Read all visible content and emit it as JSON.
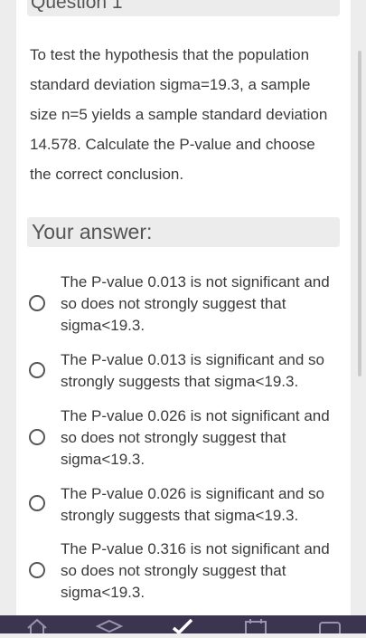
{
  "question": {
    "title": "Question 1",
    "text": "To test the hypothesis that the population standard deviation sigma=19.3, a sample size n=5 yields a sample standard deviation 14.578. Calculate the P-value and choose the correct conclusion."
  },
  "answer_header": "Your answer:",
  "options": [
    {
      "label": "The P-value 0.013 is not significant and so does not strongly suggest that sigma<19.3."
    },
    {
      "label": "The P-value 0.013 is significant and so strongly suggests that sigma<19.3."
    },
    {
      "label": "The P-value 0.026 is not significant and so does not strongly suggest that sigma<19.3."
    },
    {
      "label": "The P-value 0.026 is significant and so strongly suggests that sigma<19.3."
    },
    {
      "label": "The P-value 0.316 is not significant and so does not strongly suggest that sigma<19.3."
    }
  ],
  "tabbar": {
    "icons": [
      "home-icon",
      "graduation-cap-icon",
      "checkmark-icon",
      "calendar-icon",
      "inbox-icon"
    ]
  }
}
